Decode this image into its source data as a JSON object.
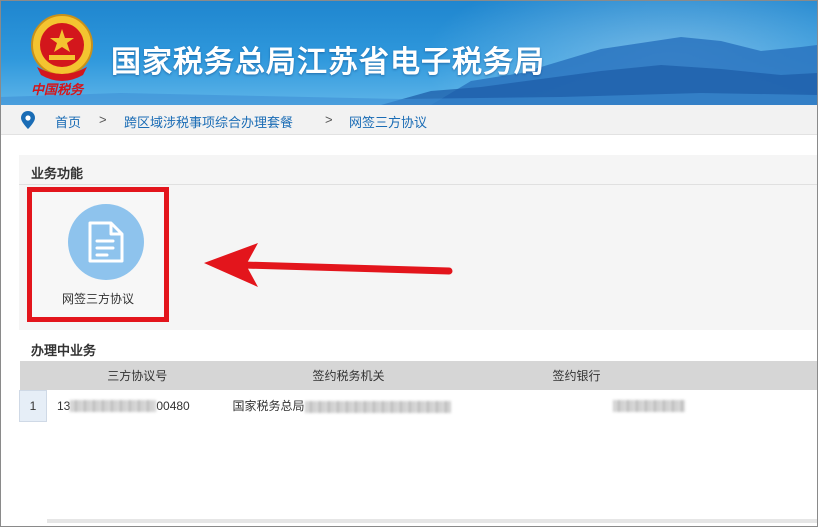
{
  "header": {
    "site_title": "国家税务总局江苏省电子税务局",
    "emblem_caption": "中国税务"
  },
  "breadcrumb": {
    "items": [
      "首页",
      "跨区域涉税事项综合办理套餐",
      "网签三方协议"
    ],
    "separator": ">"
  },
  "functions": {
    "title": "业务功能",
    "tiles": [
      {
        "label": "网签三方协议",
        "icon": "document-icon"
      }
    ]
  },
  "pending": {
    "title": "办理中业务",
    "columns": [
      "三方协议号",
      "签约税务机关",
      "签约银行"
    ],
    "rows": [
      {
        "index": "1",
        "agreement_prefix": "13",
        "agreement_suffix": "00480",
        "tax_authority_prefix": "国家税务总局",
        "bank": ""
      }
    ]
  },
  "colors": {
    "header_blue": "#1f86cf",
    "link_blue": "#1a6cb5",
    "highlight_red": "#e3151c",
    "icon_circle": "#8ec3ed"
  }
}
